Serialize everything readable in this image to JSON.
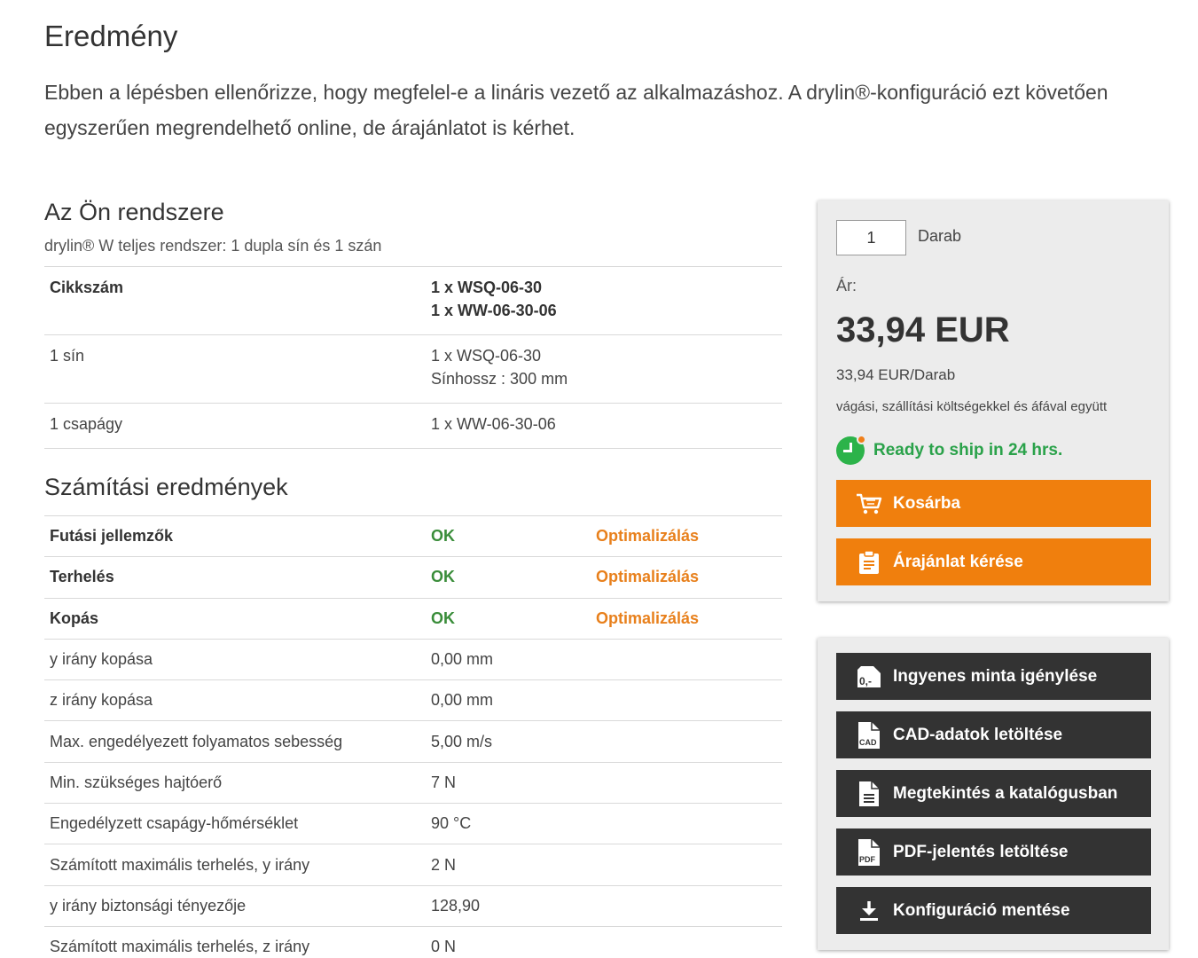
{
  "page": {
    "title": "Eredmény",
    "intro": "Ebben a lépésben ellenőrizze, hogy megfelel-e a lináris vezető az alkalmazáshoz. A drylin®-konfiguráció ezt követően egyszerűen megrendelhető online, de árajánlatot is kérhet."
  },
  "system": {
    "title": "Az Ön rendszere",
    "subtitle": "drylin® W teljes rendszer: 1 dupla sín és 1 szán",
    "rows": [
      {
        "label": "Cikkszám",
        "lines": [
          "1 x WSQ-06-30",
          "1 x WW-06-30-06"
        ]
      },
      {
        "label": "1 sín",
        "lines": [
          "1 x WSQ-06-30",
          "Sínhossz : 300 mm"
        ]
      },
      {
        "label": "1 csapágy",
        "lines": [
          "1 x WW-06-30-06"
        ]
      }
    ]
  },
  "results": {
    "title": "Számítási eredmények",
    "status_rows": [
      {
        "label": "Futási jellemzők",
        "status": "OK",
        "action": "Optimalizálás"
      },
      {
        "label": "Terhelés",
        "status": "OK",
        "action": "Optimalizálás"
      },
      {
        "label": "Kopás",
        "status": "OK",
        "action": "Optimalizálás"
      }
    ],
    "value_rows": [
      {
        "label": "y irány kopása",
        "value": "0,00 mm"
      },
      {
        "label": "z irány kopása",
        "value": "0,00 mm"
      },
      {
        "label": "Max. engedélyezett folyamatos sebesség",
        "value": "5,00 m/s"
      },
      {
        "label": "Min. szükséges hajtóerő",
        "value": "7 N"
      },
      {
        "label": "Engedélyzett csapágy-hőmérséklet",
        "value": "90 °C"
      },
      {
        "label": "Számított maximális terhelés, y irány",
        "value": "2 N"
      },
      {
        "label": "y irány biztonsági tényezője",
        "value": "128,90"
      },
      {
        "label": "Számított maximális terhelés, z irány",
        "value": "0 N"
      }
    ]
  },
  "order": {
    "quantity": "1",
    "unit": "Darab",
    "price_label": "Ár:",
    "price": "33,94 EUR",
    "price_per_unit": "33,94 EUR/Darab",
    "price_note": "vágási, szállítási költségekkel és áfával együtt",
    "shipping": "Ready to ship in 24 hrs.",
    "cart_button": "Kosárba",
    "quote_button": "Árajánlat kérése"
  },
  "actions": {
    "sample_button": "Ingyenes minta igénylése",
    "sample_icon_text": "0,-",
    "cad_button": "CAD-adatok letöltése",
    "cad_icon_text": "CAD",
    "catalog_button": "Megtekintés a katalógusban",
    "pdf_button": "PDF-jelentés letöltése",
    "pdf_icon_text": "PDF",
    "save_button": "Konfiguráció mentése"
  },
  "colors": {
    "accent_orange": "#f07f0d",
    "ok_green": "#3a8d3a",
    "optimize_orange": "#e8801c",
    "dark_button": "#333333",
    "ship_green": "#2aa24a"
  }
}
